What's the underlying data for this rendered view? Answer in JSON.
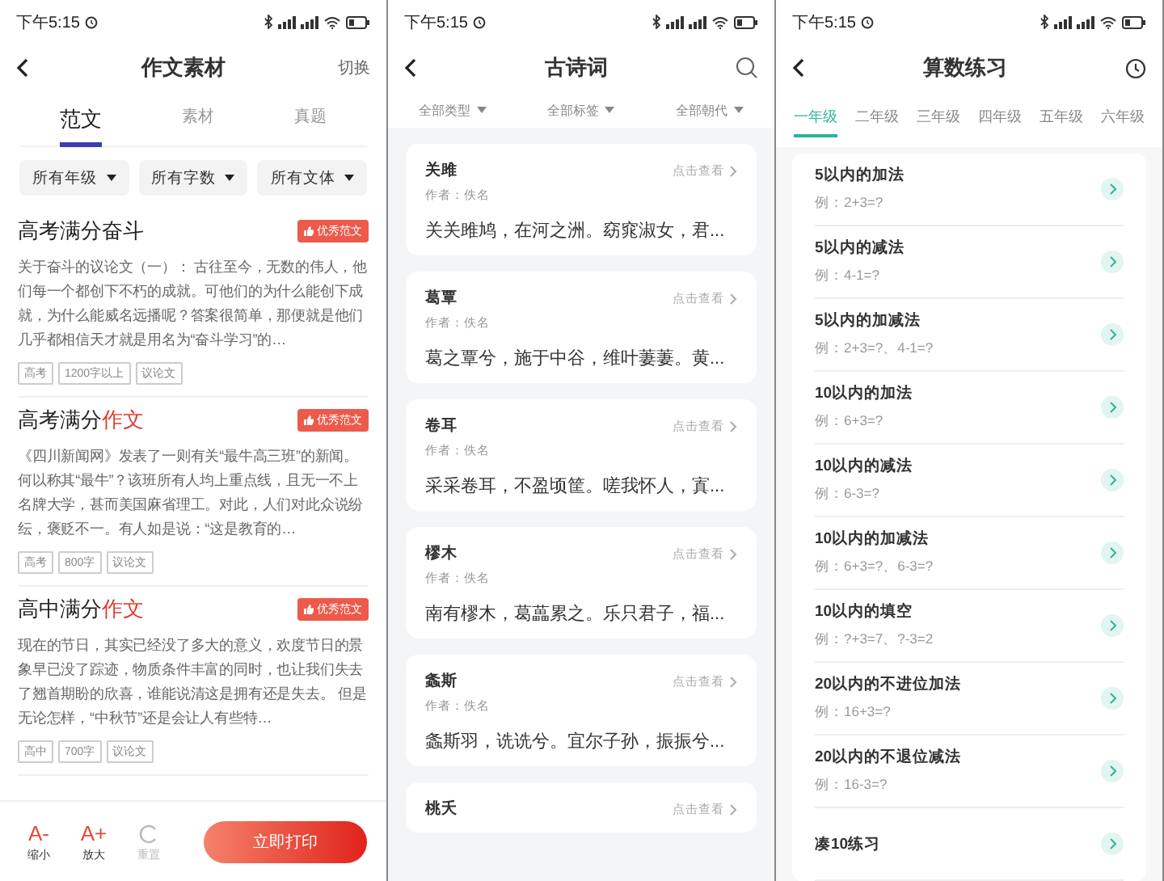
{
  "screens": [
    {
      "kind": "essay",
      "status_bar": {
        "time": "下午5:15"
      },
      "title": "作文素材",
      "action": "切换",
      "tabs": [
        {
          "label": "范文",
          "selected": true
        },
        {
          "label": "素材",
          "selected": false
        },
        {
          "label": "真题",
          "selected": false
        }
      ],
      "filters": [
        "所有年级",
        "所有字数",
        "所有文体"
      ],
      "articles": [
        {
          "title": "高考满分奋斗",
          "badge": "优秀范文",
          "body": "关于奋斗的议论文（一）： 古往至今，无数的伟人，他们每一个都创下不朽的成就。可他们的为什么能创下成就，为什么能威名远播呢？答案很简单，那便就是他们几乎都相信天才就是用名为“奋斗学习”的…",
          "tags": [
            "高考",
            "1200字以上",
            "议论文"
          ]
        },
        {
          "title": "高考满分",
          "highlight": "作文",
          "badge": "优秀范文",
          "body": "《四川新闻网》发表了一则有关“最牛高三班”的新闻。何以称其“最牛”？该班所有人均上重点线，且无一不上名牌大学，甚而美国麻省理工。对此，人们对此众说纷纭，褒贬不一。有人如是说：“这是教育的…",
          "tags": [
            "高考",
            "800字",
            "议论文"
          ]
        },
        {
          "title": "高中满分",
          "highlight": "作文",
          "badge": "优秀范文",
          "body": "现在的节日，其实已经没了多大的意义，欢度节日的景象早已没了踪迹，物质条件丰富的同时，也让我们失去了翘首期盼的欣喜，谁能说清这是拥有还是失去。 但是无论怎样，“中秋节”还是会让人有些特…",
          "tags": [
            "高中",
            "700字",
            "议论文"
          ]
        }
      ],
      "toolbar": [
        {
          "kind": "text",
          "symbol": "A-",
          "label": "缩小",
          "disabled": false
        },
        {
          "kind": "text",
          "symbol": "A+",
          "label": "放大",
          "disabled": false
        },
        {
          "kind": "reset",
          "label": "重置",
          "disabled": true
        }
      ],
      "print_button": "立即打印"
    },
    {
      "kind": "poems",
      "status_bar": {
        "time": "下午5:15"
      },
      "title": "古诗词",
      "filters": [
        "全部类型",
        "全部标签",
        "全部朝代"
      ],
      "poems": [
        {
          "title": "关雎",
          "link": "点击查看",
          "author": "作者：佚名",
          "excerpt": "关关雎鸠，在河之洲。窈窕淑女，君..."
        },
        {
          "title": "葛覃",
          "link": "点击查看",
          "author": "作者：佚名",
          "excerpt": "葛之覃兮，施于中谷，维叶萋萋。黄..."
        },
        {
          "title": "卷耳",
          "link": "点击查看",
          "author": "作者：佚名",
          "excerpt": "采采卷耳，不盈顷筐。嗟我怀人，寘..."
        },
        {
          "title": "樛木",
          "link": "点击查看",
          "author": "作者：佚名",
          "excerpt": "南有樛木，葛藟累之。乐只君子，福..."
        },
        {
          "title": "螽斯",
          "link": "点击查看",
          "author": "作者：佚名",
          "excerpt": "螽斯羽，诜诜兮。宜尔子孙，振振兮..."
        },
        {
          "title": "桃夭",
          "link": "点击查看"
        }
      ]
    },
    {
      "kind": "math",
      "status_bar": {
        "time": "下午5:15"
      },
      "title": "算数练习",
      "tabs": [
        {
          "label": "一年级",
          "selected": true
        },
        {
          "label": "二年级",
          "selected": false
        },
        {
          "label": "三年级",
          "selected": false
        },
        {
          "label": "四年级",
          "selected": false
        },
        {
          "label": "五年级",
          "selected": false
        },
        {
          "label": "六年级",
          "selected": false
        }
      ],
      "exercises": [
        {
          "title": "5以内的加法",
          "example": "例：2+3=?"
        },
        {
          "title": "5以内的减法",
          "example": "例：4-1=?"
        },
        {
          "title": "5以内的加减法",
          "example": "例：2+3=?、4-1=?"
        },
        {
          "title": "10以内的加法",
          "example": "例：6+3=?"
        },
        {
          "title": "10以内的减法",
          "example": "例：6-3=?"
        },
        {
          "title": "10以内的加减法",
          "example": "例：6+3=?、6-3=?"
        },
        {
          "title": "10以内的填空",
          "example": "例：?+3=7、?-3=2"
        },
        {
          "title": "20以内的不进位加法",
          "example": "例：16+3=?"
        },
        {
          "title": "20以内的不退位减法",
          "example": "例：16-3=?"
        },
        {
          "title": "凑10练习"
        }
      ]
    }
  ]
}
